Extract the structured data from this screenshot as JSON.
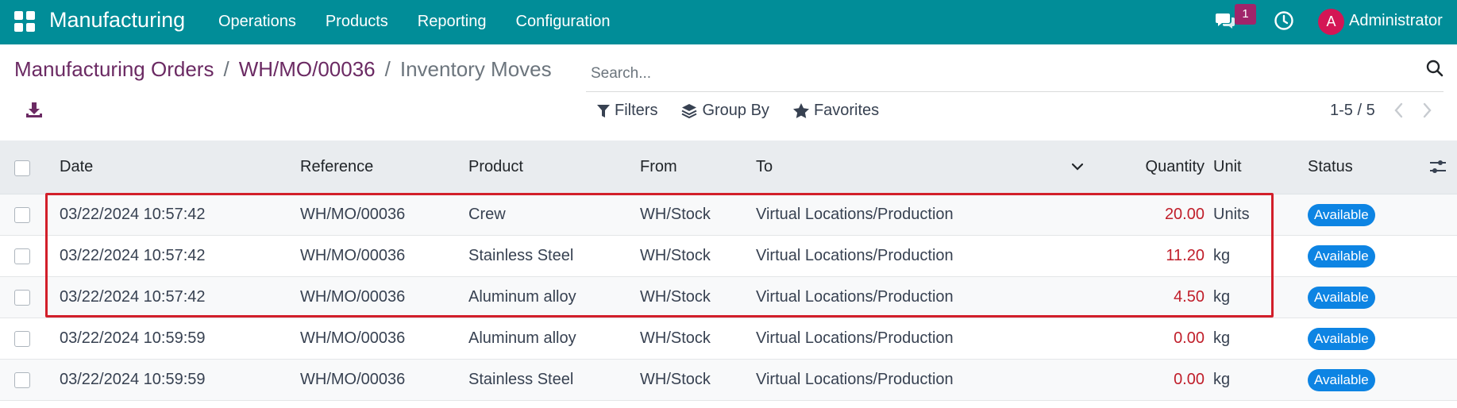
{
  "navbar": {
    "brand": "Manufacturing",
    "menu": [
      {
        "label": "Operations"
      },
      {
        "label": "Products"
      },
      {
        "label": "Reporting"
      },
      {
        "label": "Configuration"
      }
    ],
    "chat_badge": "1",
    "avatar_initial": "A",
    "user_name": "Administrator",
    "accent_color": "#018d98"
  },
  "breadcrumb": {
    "items": [
      "Manufacturing Orders",
      "WH/MO/00036"
    ],
    "separator": "/",
    "current": "Inventory Moves"
  },
  "search": {
    "placeholder": "Search..."
  },
  "filters": {
    "filters_label": "Filters",
    "group_by_label": "Group By",
    "favorites_label": "Favorites"
  },
  "pager": {
    "text": "1-5 / 5"
  },
  "table": {
    "columns": {
      "date": "Date",
      "reference": "Reference",
      "product": "Product",
      "from": "From",
      "to": "To",
      "quantity": "Quantity",
      "unit": "Unit",
      "status": "Status"
    },
    "rows": [
      {
        "date": "03/22/2024 10:57:42",
        "reference": "WH/MO/00036",
        "product": "Crew",
        "from": "WH/Stock",
        "to": "Virtual Locations/Production",
        "quantity": "20.00",
        "unit": "Units",
        "status": "Available"
      },
      {
        "date": "03/22/2024 10:57:42",
        "reference": "WH/MO/00036",
        "product": "Stainless Steel",
        "from": "WH/Stock",
        "to": "Virtual Locations/Production",
        "quantity": "11.20",
        "unit": "kg",
        "status": "Available"
      },
      {
        "date": "03/22/2024 10:57:42",
        "reference": "WH/MO/00036",
        "product": "Aluminum alloy",
        "from": "WH/Stock",
        "to": "Virtual Locations/Production",
        "quantity": "4.50",
        "unit": "kg",
        "status": "Available"
      },
      {
        "date": "03/22/2024 10:59:59",
        "reference": "WH/MO/00036",
        "product": "Aluminum alloy",
        "from": "WH/Stock",
        "to": "Virtual Locations/Production",
        "quantity": "0.00",
        "unit": "kg",
        "status": "Available"
      },
      {
        "date": "03/22/2024 10:59:59",
        "reference": "WH/MO/00036",
        "product": "Stainless Steel",
        "from": "WH/Stock",
        "to": "Virtual Locations/Production",
        "quantity": "0.00",
        "unit": "kg",
        "status": "Available"
      }
    ]
  },
  "colors": {
    "status_badge": "#0d84e3",
    "quantity_negative": "#c01e2a",
    "breadcrumb_link": "#6b2a63",
    "highlight": "#d21f2a"
  }
}
